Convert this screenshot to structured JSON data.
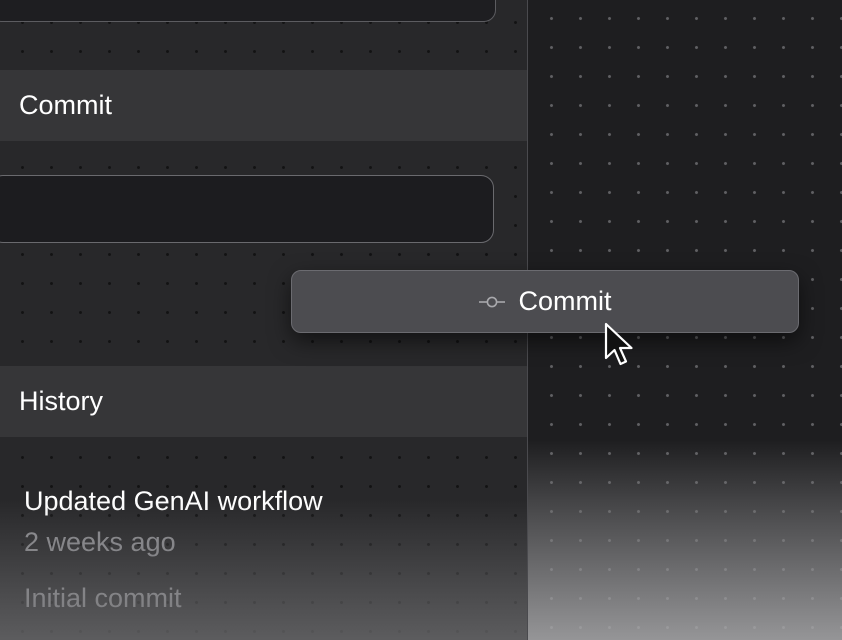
{
  "commit_section": {
    "header": "Commit",
    "message_value": "",
    "button_label": "Commit",
    "button_icon": "commit-icon"
  },
  "history_section": {
    "header": "History",
    "items": [
      {
        "title": "Updated GenAI workflow",
        "time": "2 weeks ago"
      },
      {
        "title": "Initial commit"
      }
    ]
  },
  "cursor": {
    "icon": "pointer-cursor-icon"
  }
}
